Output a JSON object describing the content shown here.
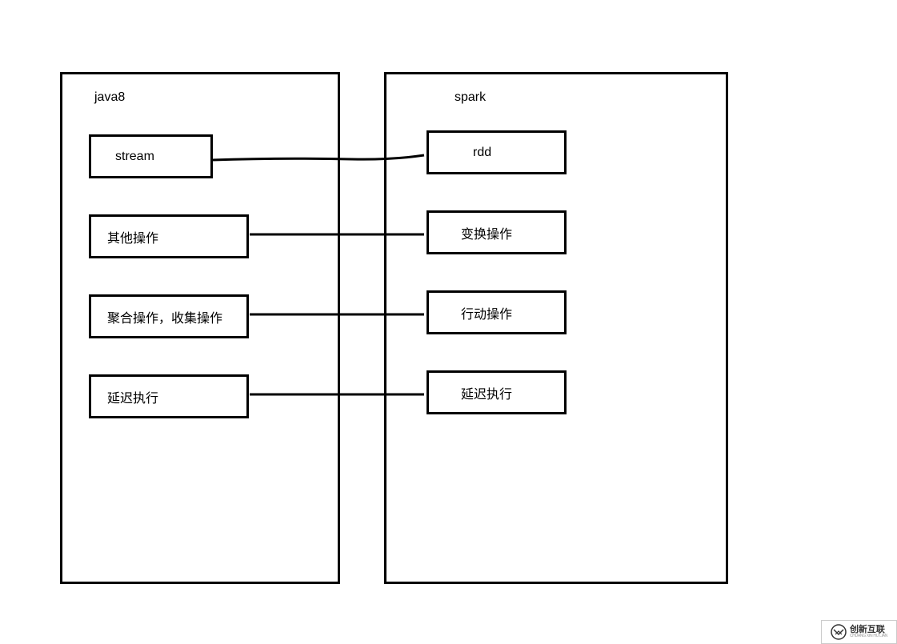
{
  "diagram": {
    "left": {
      "title": "java8",
      "boxes": [
        {
          "label": "stream"
        },
        {
          "label": "其他操作"
        },
        {
          "label": "聚合操作，收集操作"
        },
        {
          "label": "延迟执行"
        }
      ]
    },
    "right": {
      "title": "spark",
      "boxes": [
        {
          "label": "rdd"
        },
        {
          "label": "变换操作"
        },
        {
          "label": "行动操作"
        },
        {
          "label": "延迟执行"
        }
      ]
    }
  },
  "watermark": {
    "main": "创新互联",
    "sub": "CHUANG XIN HU LIAN"
  }
}
